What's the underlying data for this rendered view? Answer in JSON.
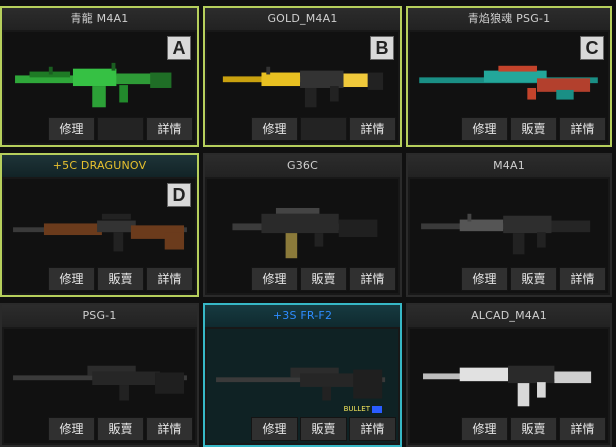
{
  "cards": [
    {
      "title": "青龍 M4A1",
      "letter": "A",
      "btn1": "修理",
      "btn2": "",
      "btn3": "詳情"
    },
    {
      "title": "GOLD_M4A1",
      "letter": "B",
      "btn1": "修理",
      "btn2": "",
      "btn3": "詳情"
    },
    {
      "title": "青焰狼魂 PSG-1",
      "letter": "C",
      "btn1": "修理",
      "btn2": "販賣",
      "btn3": "詳情"
    },
    {
      "title": "+5C DRAGUNOV",
      "letter": "D",
      "btn1": "修理",
      "btn2": "販賣",
      "btn3": "詳情"
    },
    {
      "title": "G36C",
      "btn1": "修理",
      "btn2": "販賣",
      "btn3": "詳情"
    },
    {
      "title": "M4A1",
      "btn1": "修理",
      "btn2": "販賣",
      "btn3": "詳情"
    },
    {
      "title": "PSG-1",
      "btn1": "修理",
      "btn2": "販賣",
      "btn3": "詳情"
    },
    {
      "title": "+3S FR-F2",
      "btn1": "修理",
      "btn2": "販賣",
      "btn3": "詳情",
      "badge": "BULLET"
    },
    {
      "title": "ALCAD_M4A1",
      "btn1": "修理",
      "btn2": "販賣",
      "btn3": "詳情"
    }
  ],
  "colors": {
    "highlight_green": "#b6cf5c",
    "highlight_cyan": "#37b8c6",
    "gold_title": "#e7c12e",
    "blue_title": "#2e8cff"
  }
}
